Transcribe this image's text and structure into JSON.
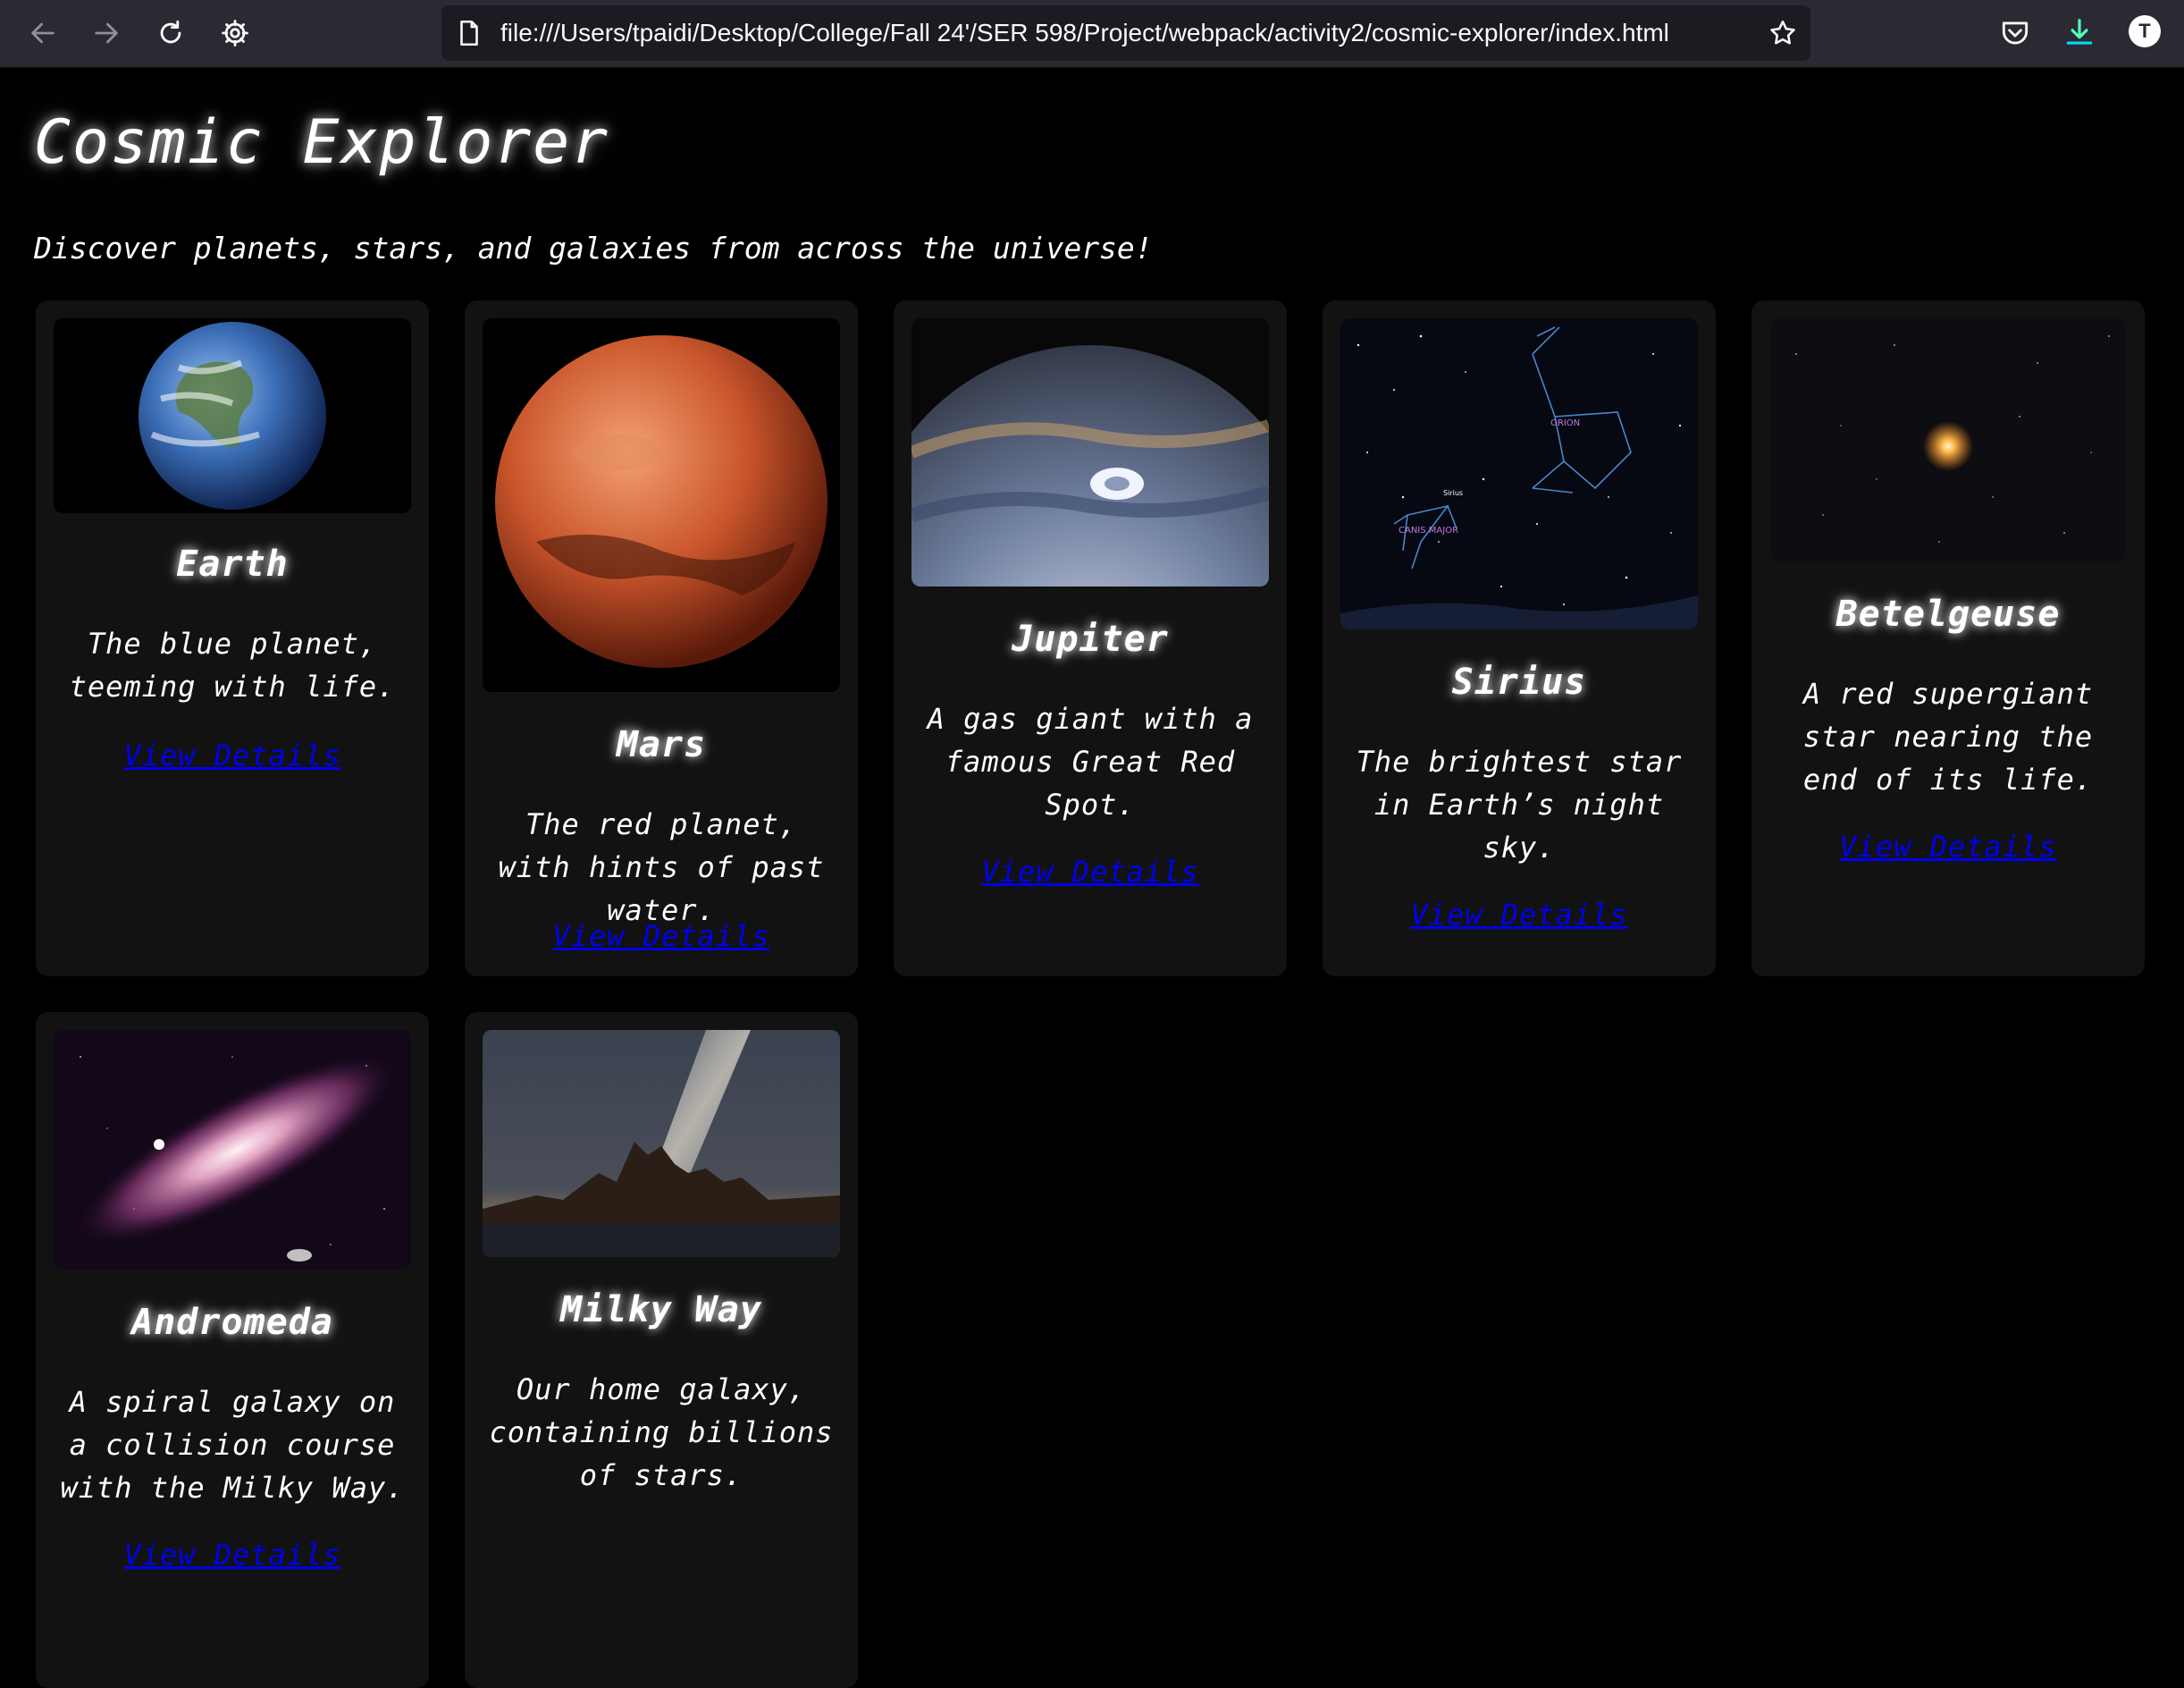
{
  "browser": {
    "url": "file:///Users/tpaidi/Desktop/College/Fall 24'/SER 598/Project/webpack/activity2/cosmic-explorer/index.html",
    "avatar_letter": "T"
  },
  "page": {
    "title": "Cosmic Explorer",
    "subtitle": "Discover planets, stars, and galaxies from across the universe!"
  },
  "cards": [
    {
      "name": "Earth",
      "description": "The blue planet, teeming with life.",
      "link": "View Details"
    },
    {
      "name": "Mars",
      "description": "The red planet, with hints of past water.",
      "link": "View Details"
    },
    {
      "name": "Jupiter",
      "description": "A gas giant with a famous Great Red Spot.",
      "link": "View Details"
    },
    {
      "name": "Sirius",
      "description": "The brightest star in Earth’s night sky.",
      "link": "View Details"
    },
    {
      "name": "Betelgeuse",
      "description": "A red supergiant star nearing the end of its life.",
      "link": "View Details"
    },
    {
      "name": "Andromeda",
      "description": "A spiral galaxy on a collision course with the Milky Way.",
      "link": "View Details"
    },
    {
      "name": "Milky Way",
      "description": "Our home galaxy, containing billions of stars.",
      "link": "View Details"
    }
  ],
  "image_labels": {
    "orion": "ORION",
    "sirius": "Sirius",
    "canis_major": "CANIS MAJOR"
  },
  "colors": {
    "background": "#000000",
    "card": "#121212",
    "link": "#0000ee",
    "chrome": "#2b2a33"
  }
}
